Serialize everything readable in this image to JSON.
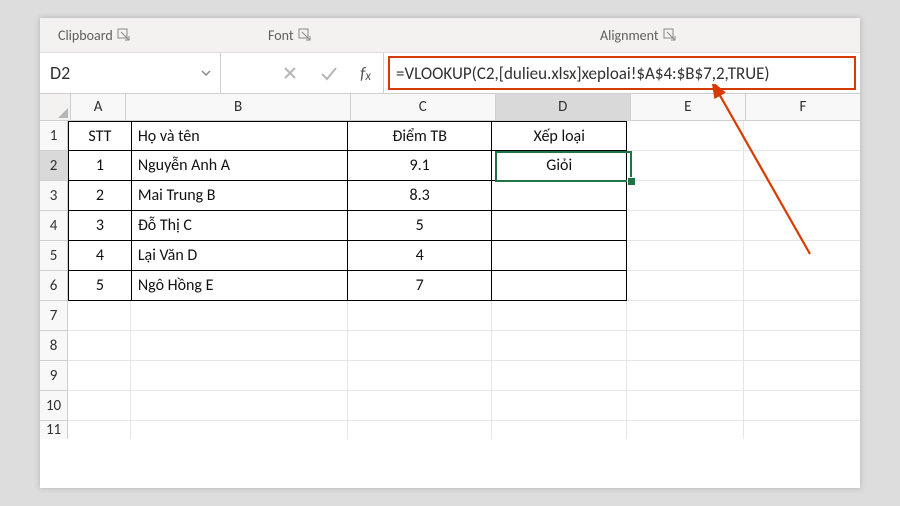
{
  "ribbon": {
    "clipboard": "Clipboard",
    "font": "Font",
    "alignment": "Alignment"
  },
  "formula_bar": {
    "name_box": "D2",
    "formula": "=VLOOKUP(C2,[dulieu.xlsx]xeploai!$A$4:$B$7,2,TRUE)"
  },
  "columns": [
    "A",
    "B",
    "C",
    "D",
    "E",
    "F"
  ],
  "active_cell": "D2",
  "table": {
    "headers": {
      "stt": "STT",
      "name": "Họ và tên",
      "score": "Điểm TB",
      "grade": "Xếp loại"
    },
    "rows": [
      {
        "stt": "1",
        "name": "Nguyễn Anh A",
        "score": "9.1",
        "grade": "Giỏi"
      },
      {
        "stt": "2",
        "name": "Mai Trung B",
        "score": "8.3",
        "grade": ""
      },
      {
        "stt": "3",
        "name": "Đỗ Thị C",
        "score": "5",
        "grade": ""
      },
      {
        "stt": "4",
        "name": "Lại Văn D",
        "score": "4",
        "grade": ""
      },
      {
        "stt": "5",
        "name": "Ngô Hồng E",
        "score": "7",
        "grade": ""
      }
    ]
  },
  "row_headers": [
    "1",
    "2",
    "3",
    "4",
    "5",
    "6",
    "7",
    "8",
    "9",
    "10",
    "11"
  ]
}
